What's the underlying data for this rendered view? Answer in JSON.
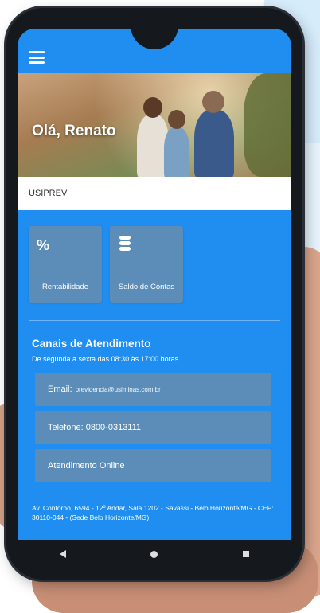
{
  "header": {
    "menu_icon": "hamburger-menu-icon",
    "greeting": "Olá, Renato"
  },
  "org": {
    "name": "USIPREV"
  },
  "tiles": [
    {
      "label": "Rentabilidade",
      "icon": "percent-icon"
    },
    {
      "label": "Saldo de Contas",
      "icon": "coins-stack-icon"
    }
  ],
  "channels": {
    "title": "Canais de Atendimento",
    "subtitle": "De segunda a sexta das 08:30 às 17:00 horas",
    "items": [
      {
        "label": "Email:",
        "detail": "previdencia@usiminas.com.br"
      },
      {
        "label": "Telefone: 0800-0313111",
        "detail": ""
      },
      {
        "label": "Atendimento Online",
        "detail": ""
      }
    ]
  },
  "address": "Av. Contorno, 6594 - 12º Andar, Sala 1202 - Savassi - Belo Horizonte/MG - CEP: 30110-044 - (Sede Belo Horizonte/MG)",
  "colors": {
    "screen_blue": "#1f8ef0",
    "tile_blue": "#5b8db8"
  }
}
